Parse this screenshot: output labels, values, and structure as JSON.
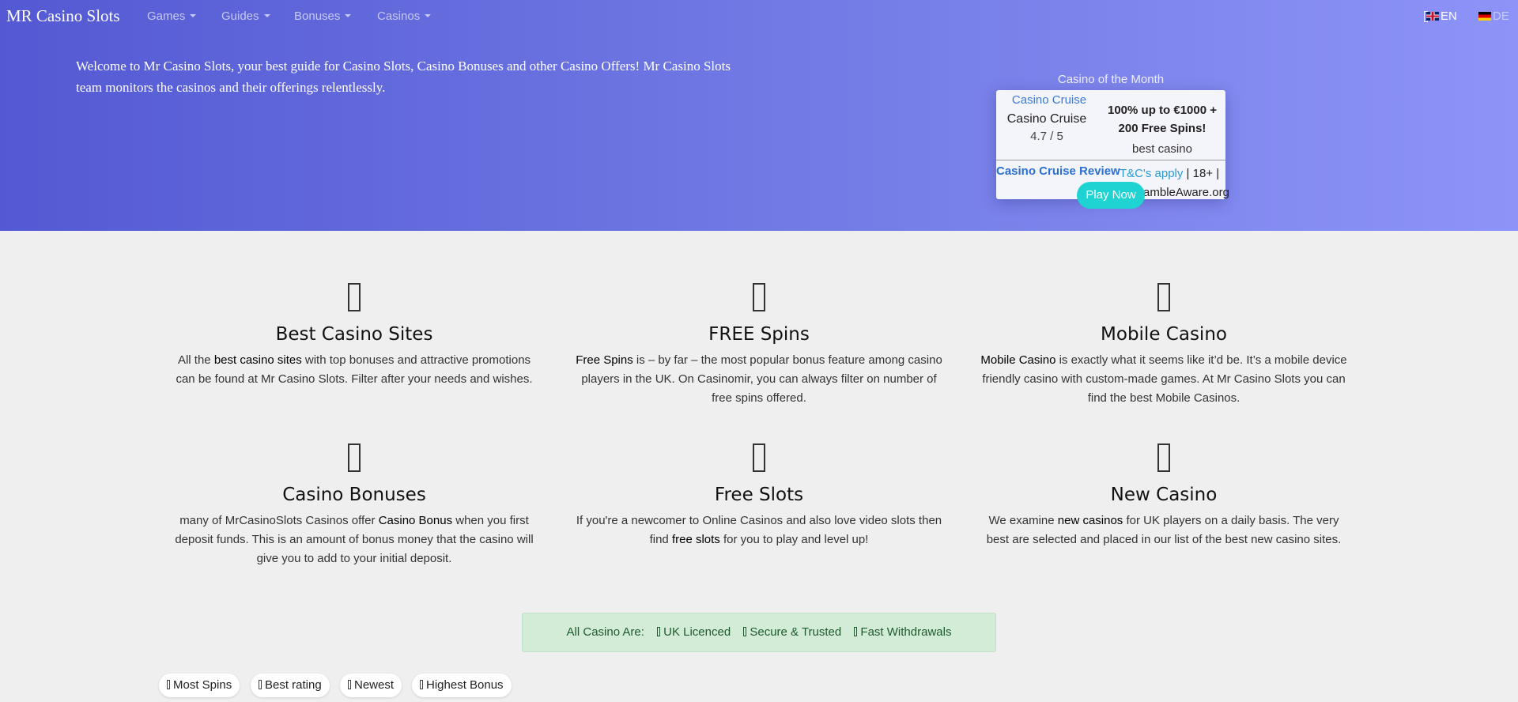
{
  "navbar": {
    "brand": "MR Casino Slots",
    "items": [
      {
        "label": "Games"
      },
      {
        "label": "Guides"
      },
      {
        "label": "Bonuses"
      },
      {
        "label": "Casinos"
      }
    ],
    "languages": [
      {
        "code": "EN",
        "flag": "uk-flag-icon",
        "active": true
      },
      {
        "code": "DE",
        "flag": "de-flag-icon",
        "active": false
      }
    ]
  },
  "hero": {
    "welcome": "Welcome to Mr Casino Slots, your best guide for Casino Slots, Casino Bonuses and other Casino Offers! Mr Casino Slots team monitors the casinos and their offerings relentlessly."
  },
  "casino_of_month": {
    "title": "Casino of the Month",
    "image_alt": "Casino Cruise",
    "name": "Casino Cruise",
    "rating": "4.7 / 5 ",
    "offer": "100% up to €1000 + 200 Free Spins!",
    "tag": "best casino",
    "review_link": "Casino Cruise Review",
    "terms_link": "T&C's apply",
    "terms_rest": " | 18+ | BeGambleAware.org",
    "play_button": "Play Now"
  },
  "features": [
    {
      "icon": "casino-chip-icon",
      "title": "Best Casino Sites",
      "pre": "All the ",
      "bold": "best casino sites",
      "post": " with top bonuses and attractive promotions can be found at Mr Casino Slots. Filter after your needs and wishes."
    },
    {
      "icon": "free-spins-icon",
      "title": "FREE Spins",
      "pre": "",
      "bold": "Free Spins",
      "post": " is – by far – the most popular bonus feature among casino players in the UK. On Casinomir, you can always filter on number of free spins offered."
    },
    {
      "icon": "mobile-icon",
      "title": "Mobile Casino",
      "pre": "",
      "bold": "Mobile Casino",
      "post": " is exactly what it seems like it’d be. It’s a mobile device friendly casino with custom-made games. At Mr Casino Slots you can find the best Mobile Casinos."
    },
    {
      "icon": "gift-icon",
      "title": "Casino Bonuses",
      "pre": "many of MrCasinoSlots Casinos offer ",
      "bold": "Casino Bonus",
      "post": " when you first deposit funds. This is an amount of bonus money that the casino will give you to add to your initial deposit."
    },
    {
      "icon": "slot-machine-icon",
      "title": "Free Slots",
      "pre": "If you're a newcomer to Online Casinos and also love video slots then find ",
      "bold": "free slots",
      "post": " for you to play and level up!"
    },
    {
      "icon": "new-star-icon",
      "title": "New Casino",
      "pre": "We examine ",
      "bold": "new casinos",
      "post": " for UK players on a daily basis. The very best are selected and placed in our list of the best new casino sites."
    }
  ],
  "trust_bar": {
    "label": "All Casino Are:",
    "items": [
      "UK Licenced",
      "Secure & Trusted",
      "Fast Withdrawals"
    ]
  },
  "filters": [
    "Most Spins",
    "Best rating",
    "Newest",
    "Highest Bonus"
  ],
  "colors": {
    "hero_start": "#5459d3",
    "hero_end": "#8d93f7",
    "play_button": "#1fd3d3",
    "trust_bg": "#d3ecd8",
    "link": "#2b6fd1"
  }
}
